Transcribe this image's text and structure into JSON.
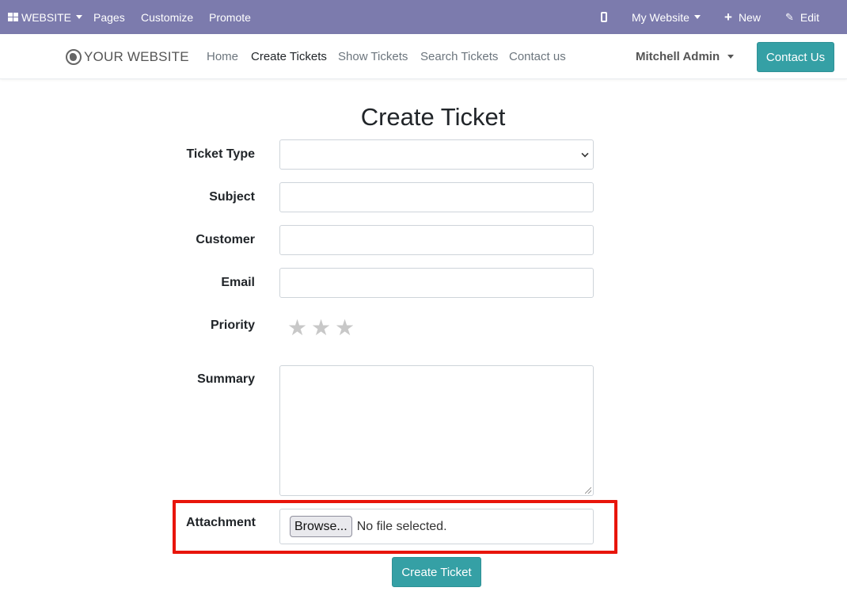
{
  "admin_bar": {
    "website_menu": "WEBSITE",
    "pages": "Pages",
    "customize": "Customize",
    "promote": "Promote",
    "my_website": "My Website",
    "new": "New",
    "edit": "Edit"
  },
  "header": {
    "logo_text": "YOUR WEBSITE",
    "nav": [
      {
        "label": "Home"
      },
      {
        "label": "Create Tickets"
      },
      {
        "label": "Show Tickets"
      },
      {
        "label": "Search Tickets"
      },
      {
        "label": "Contact us"
      }
    ],
    "user_name": "Mitchell Admin",
    "contact_button": "Contact Us"
  },
  "form": {
    "title": "Create Ticket",
    "ticket_type_label": "Ticket Type",
    "ticket_type_value": "",
    "subject_label": "Subject",
    "subject_value": "",
    "customer_label": "Customer",
    "customer_value": "",
    "email_label": "Email",
    "email_value": "",
    "priority_label": "Priority",
    "priority_stars": 3,
    "priority_value": 0,
    "summary_label": "Summary",
    "summary_value": "",
    "attachment_label": "Attachment",
    "browse_button": "Browse...",
    "file_status": "No file selected.",
    "submit_button": "Create Ticket"
  },
  "colors": {
    "admin_bar": "#7c7bad",
    "accent": "#35a0a5",
    "highlight": "#e8150b",
    "star_empty": "#c8c8c8"
  }
}
